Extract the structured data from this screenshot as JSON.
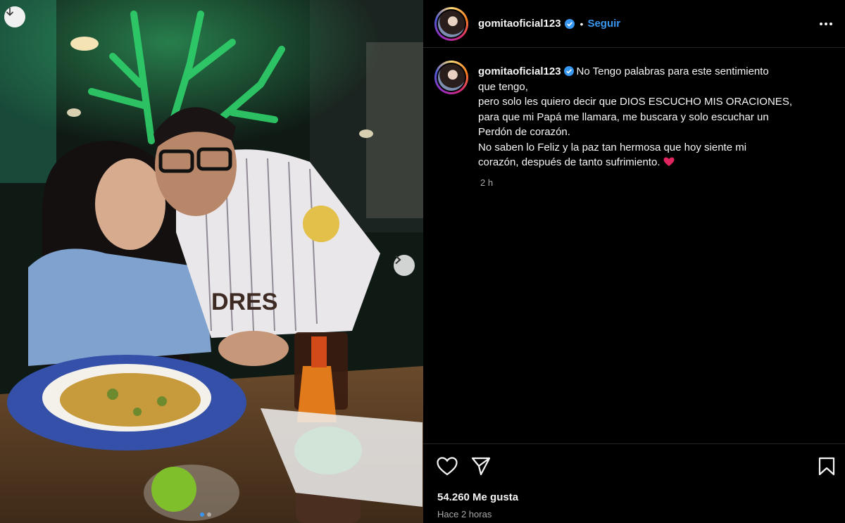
{
  "photo": {
    "slide_count": 2,
    "active_slide": 1
  },
  "post": {
    "username": "gomitaoficial123",
    "follow_label": "Seguir",
    "separator": "•",
    "caption": [
      "No Tengo palabras para este sentimiento",
      "que tengo,",
      "pero solo les quiero decir que DIOS ESCUCHO MIS ORACIONES,",
      "para que mi Papá me llamara, me buscara y solo escuchar un",
      "Perdón de corazón.",
      "No saben lo Feliz y la paz tan hermosa que hoy siente mi",
      "corazón, después de tanto sufrimiento."
    ],
    "caption_time": "2 h",
    "likes": "54.260 Me gusta",
    "posted_ago": "Hace 2 horas"
  },
  "colors": {
    "follow": "#3897f0",
    "verified": "#3897f0",
    "heart": "#e0245e"
  }
}
